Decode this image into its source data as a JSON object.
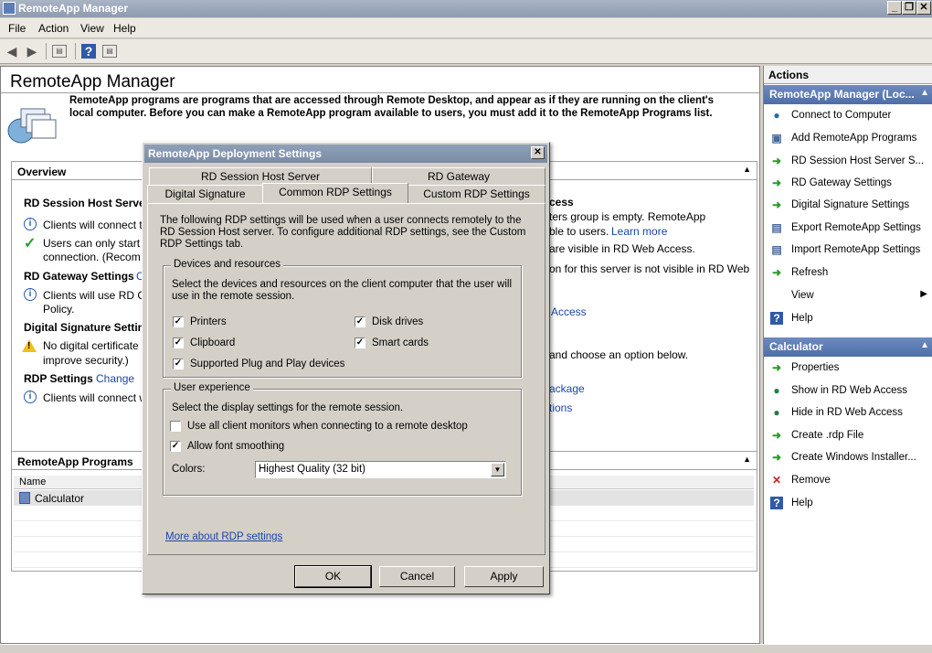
{
  "window": {
    "title": "RemoteApp Manager",
    "controls": [
      "_",
      "❐",
      "✕"
    ]
  },
  "menu": [
    "File",
    "Action",
    "View",
    "Help"
  ],
  "main": {
    "title": "RemoteApp Manager",
    "intro": "RemoteApp programs are programs that are accessed through Remote Desktop, and appear as if they are running on the client's local computer. Before you can make a RemoteApp program available to users, you must add it to the RemoteApp Programs list.",
    "overview": {
      "title": "Overview",
      "rdsh_heading": "RD Session Host Server",
      "rdsh_line1": "Clients will connect t",
      "rdsh_line2": "Users can only start l",
      "rdsh_line3": "connection. (Recom",
      "gateway_heading": "RD Gateway Settings",
      "gateway_link": "C",
      "gateway_line1": "Clients will use RD G",
      "gateway_line2": "Policy.",
      "sig_heading": "Digital Signature Settin",
      "sig_line1": "No digital certificate",
      "sig_line2": "improve security.)",
      "rdp_heading": "RDP Settings",
      "rdp_link": "Change",
      "rdp_line1": "Clients will connect w",
      "right_heading": "cess",
      "right_line1": "ters group is empty. RemoteApp",
      "right_line2": "ble to users.",
      "right_learn": "Learn more",
      "right_line3": "are visible in RD Web Access.",
      "right_line4": "on for this server is not visible in RD Web",
      "right_access": "Access",
      "right_line5": "and choose an option below.",
      "right_package": "ackage",
      "right_options": "tions"
    },
    "programs": {
      "title": "RemoteApp Programs",
      "col_name": "Name",
      "rows": [
        "Calculator"
      ]
    }
  },
  "actions": {
    "title": "Actions",
    "group1": {
      "title": "RemoteApp Manager (Loc...",
      "items": [
        {
          "icon": "connect-icon",
          "label": "Connect to Computer"
        },
        {
          "icon": "add-icon",
          "label": "Add RemoteApp Programs"
        },
        {
          "icon": "settings-arrow-icon",
          "label": "RD Session Host Server S..."
        },
        {
          "icon": "settings-arrow-icon",
          "label": "RD Gateway Settings"
        },
        {
          "icon": "settings-arrow-icon",
          "label": "Digital Signature Settings"
        },
        {
          "icon": "export-icon",
          "label": "Export RemoteApp Settings"
        },
        {
          "icon": "import-icon",
          "label": "Import RemoteApp Settings"
        },
        {
          "icon": "refresh-icon",
          "label": "Refresh"
        },
        {
          "icon": "",
          "label": "View"
        },
        {
          "icon": "help-icon",
          "label": "Help"
        }
      ]
    },
    "group2": {
      "title": "Calculator",
      "items": [
        {
          "icon": "properties-icon",
          "label": "Properties"
        },
        {
          "icon": "globe-icon",
          "label": "Show in RD Web Access"
        },
        {
          "icon": "globe-icon",
          "label": "Hide in RD Web Access"
        },
        {
          "icon": "rdp-file-icon",
          "label": "Create .rdp File"
        },
        {
          "icon": "installer-icon",
          "label": "Create Windows Installer..."
        },
        {
          "icon": "remove-icon",
          "label": "Remove"
        },
        {
          "icon": "help-icon",
          "label": "Help"
        }
      ]
    }
  },
  "dialog": {
    "title": "RemoteApp Deployment Settings",
    "tabs_back": [
      "RD Session Host Server",
      "RD Gateway"
    ],
    "tabs_front": [
      "Digital Signature",
      "Common RDP Settings",
      "Custom RDP Settings"
    ],
    "description": "The following RDP settings will be used when a user connects remotely to the RD Session Host server.  To configure additional RDP settings, see the Custom RDP Settings tab.",
    "devices": {
      "label": "Devices and resources",
      "text": "Select the devices and resources on the client computer that the user will use in the remote session.",
      "items": [
        {
          "label": "Printers",
          "checked": true
        },
        {
          "label": "Disk drives",
          "checked": true
        },
        {
          "label": "Clipboard",
          "checked": true
        },
        {
          "label": "Smart cards",
          "checked": true
        },
        {
          "label": "Supported Plug and Play devices",
          "checked": true
        }
      ]
    },
    "experience": {
      "label": "User experience",
      "text": "Select the display settings for the remote session.",
      "monitors": {
        "label": "Use all client monitors when connecting to a remote desktop",
        "checked": false
      },
      "smoothing": {
        "label": "Allow font smoothing",
        "checked": true
      },
      "colors_label": "Colors:",
      "colors_value": "Highest Quality (32 bit)"
    },
    "more_link": "More about RDP settings",
    "buttons": {
      "ok": "OK",
      "cancel": "Cancel",
      "apply": "Apply"
    }
  }
}
